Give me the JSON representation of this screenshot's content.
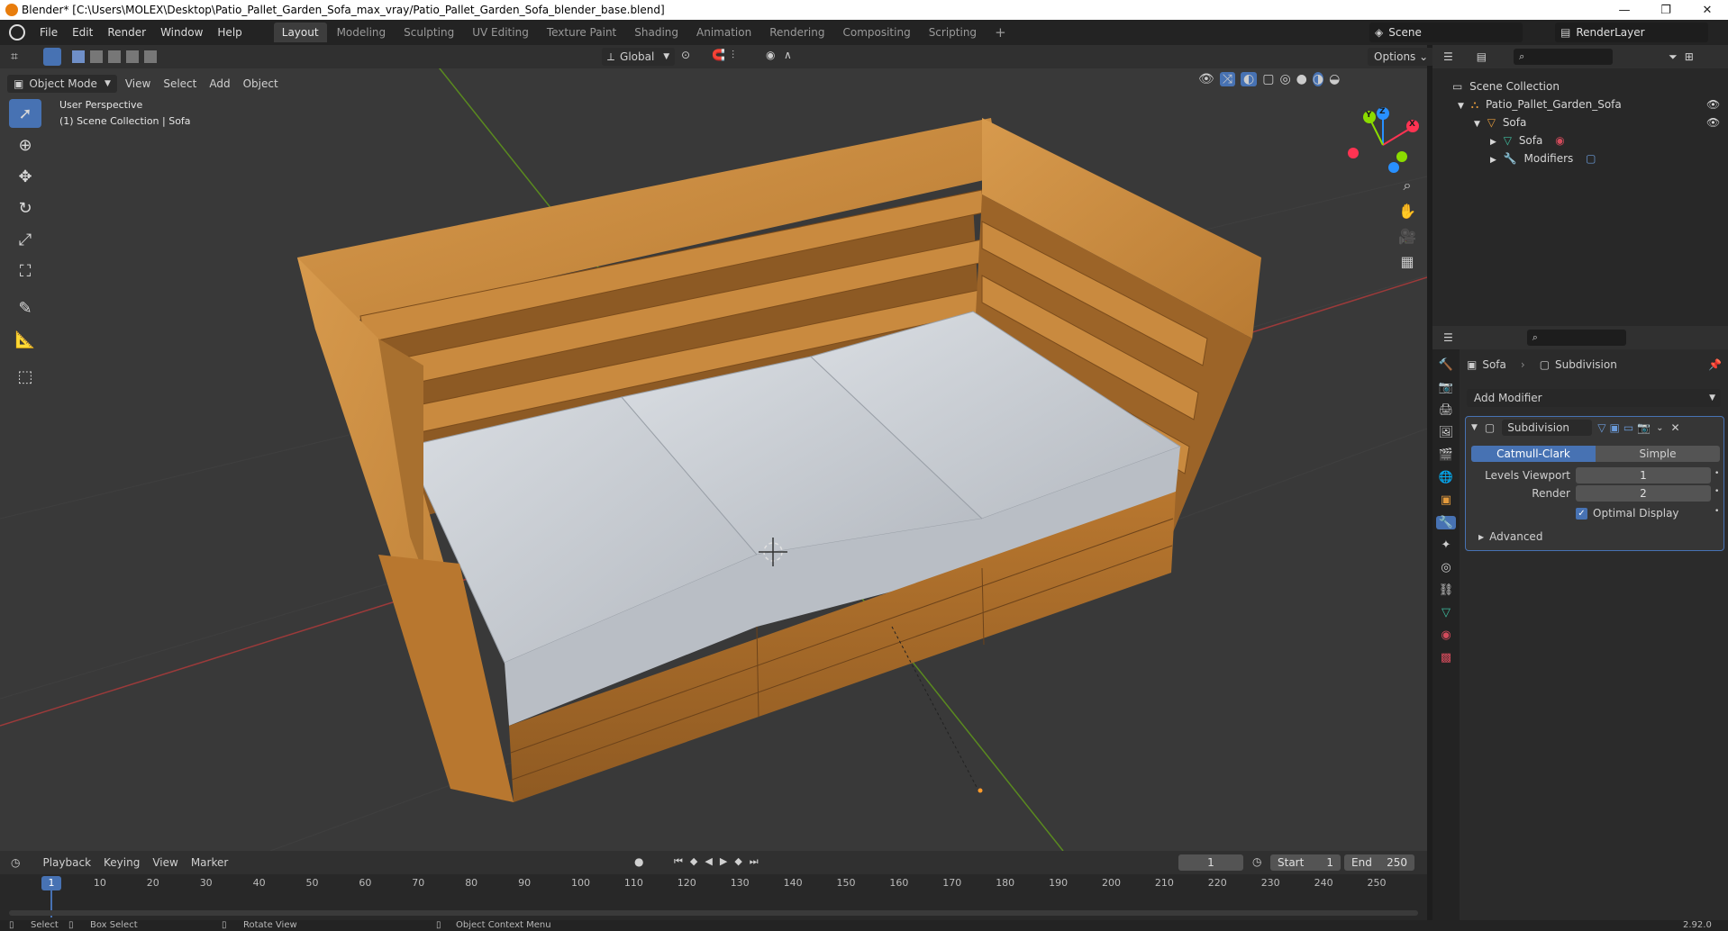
{
  "titlebar": {
    "title": "Blender* [C:\\Users\\MOLEX\\Desktop\\Patio_Pallet_Garden_Sofa_max_vray/Patio_Pallet_Garden_Sofa_blender_base.blend]",
    "minimize": "—",
    "restore": "❐",
    "close": "✕"
  },
  "menu": {
    "items": [
      "File",
      "Edit",
      "Render",
      "Window",
      "Help"
    ]
  },
  "workspaces": {
    "tabs": [
      "Layout",
      "Modeling",
      "Sculpting",
      "UV Editing",
      "Texture Paint",
      "Shading",
      "Animation",
      "Rendering",
      "Compositing",
      "Scripting"
    ],
    "active": "Layout",
    "add": "+"
  },
  "scene": {
    "label": "Scene",
    "render_layer": "RenderLayer"
  },
  "viewport_header": {
    "mode": "Object Mode",
    "menus": [
      "View",
      "Select",
      "Add",
      "Object"
    ],
    "transform_orientation": "Global",
    "options": "Options"
  },
  "viewport": {
    "perspective": "User Perspective",
    "collection": "(1) Scene Collection | Sofa",
    "gizmo": {
      "x": "X",
      "y": "Y",
      "z": "Z"
    }
  },
  "toolbar": {
    "tools": [
      "select-box-tool",
      "cursor-tool",
      "move-tool",
      "rotate-tool",
      "scale-tool",
      "transform-tool",
      "annotate-tool",
      "measure-tool",
      "add-cube-tool"
    ]
  },
  "outliner": {
    "rows": [
      {
        "label": "Scene Collection",
        "icon": "scene-collection-icon"
      },
      {
        "label": "Patio_Pallet_Garden_Sofa",
        "icon": "collection-icon"
      },
      {
        "label": "Sofa",
        "icon": "object-icon"
      },
      {
        "label": "Sofa",
        "icon": "mesh-data-icon"
      },
      {
        "label": "Modifiers",
        "icon": "modifier-icon"
      }
    ]
  },
  "properties": {
    "breadcrumb_object": "Sofa",
    "breadcrumb_modifier": "Subdivision",
    "add_modifier": "Add Modifier",
    "modifier_name": "Subdivision",
    "subdiv_types": [
      "Catmull-Clark",
      "Simple"
    ],
    "active_type": "Catmull-Clark",
    "levels_viewport_label": "Levels Viewport",
    "levels_viewport_value": "1",
    "render_label": "Render",
    "render_value": "2",
    "optimal_display": "Optimal Display",
    "advanced": "Advanced"
  },
  "timeline": {
    "menus": [
      "Playback",
      "Keying",
      "View",
      "Marker"
    ],
    "current_frame": "1",
    "start_label": "Start",
    "start_value": "1",
    "end_label": "End",
    "end_value": "250",
    "ruler": [
      "1",
      "10",
      "20",
      "30",
      "40",
      "50",
      "60",
      "70",
      "80",
      "90",
      "100",
      "110",
      "120",
      "130",
      "140",
      "150",
      "160",
      "170",
      "180",
      "190",
      "200",
      "210",
      "220",
      "230",
      "240",
      "250"
    ]
  },
  "statusbar": {
    "items": [
      "Select",
      "Box Select",
      "Rotate View",
      "Object Context Menu"
    ],
    "version": "2.92.0"
  },
  "colors": {
    "accent": "#4772b3",
    "wood": "#c98a3f",
    "cushion": "#c8ccd2",
    "x_axis": "#ff3352",
    "y_axis": "#8bdc00",
    "z_axis": "#2890ff"
  }
}
